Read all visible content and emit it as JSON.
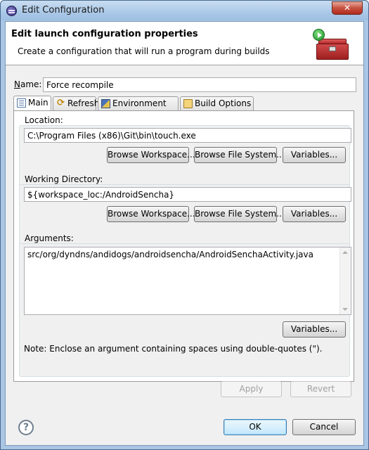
{
  "window": {
    "title": "Edit Configuration",
    "close_label": "✕"
  },
  "banner": {
    "title": "Edit launch configuration properties",
    "description": "Create a configuration that will run a program during builds",
    "icon": "toolbox-run-icon"
  },
  "name": {
    "label_accel": "N",
    "label_rest": "ame:",
    "value": "Force recompile"
  },
  "tabs": [
    {
      "label": "Main",
      "icon": "main-tab-icon",
      "active": true
    },
    {
      "label": "Refresh",
      "icon": "refresh-icon",
      "active": false
    },
    {
      "label": "Environment",
      "icon": "environment-icon",
      "active": false
    },
    {
      "label": "Build Options",
      "icon": "build-options-icon",
      "active": false
    }
  ],
  "location": {
    "label": "Location:",
    "value": "C:\\Program Files (x86)\\Git\\bin\\touch.exe",
    "browse_workspace": "Browse Workspace...",
    "browse_filesystem": "Browse File System...",
    "variables": "Variables..."
  },
  "working_directory": {
    "label": "Working Directory:",
    "value": "${workspace_loc:/AndroidSencha}",
    "browse_workspace": "Browse Workspace...",
    "browse_filesystem": "Browse File System...",
    "variables": "Variables..."
  },
  "arguments": {
    "label": "Arguments:",
    "value": "src/org/dyndns/andidogs/androidsencha/AndroidSenchaActivity.java",
    "variables": "Variables...",
    "note": "Note: Enclose an argument containing spaces using double-quotes (\")."
  },
  "actions": {
    "apply": "Apply",
    "revert": "Revert",
    "ok": "OK",
    "cancel": "Cancel",
    "help": "?"
  },
  "colors": {
    "title_bar": "#aac8e7",
    "close_button": "#c75040",
    "dialog_bg": "#f0f0f0"
  }
}
